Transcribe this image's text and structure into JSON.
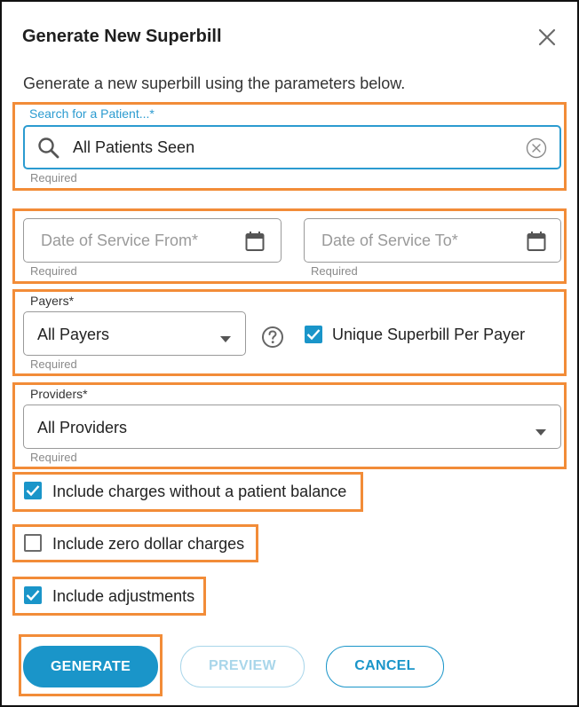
{
  "dialog": {
    "title": "Generate New Superbill",
    "subtitle": "Generate a new superbill using the parameters below."
  },
  "patient": {
    "label": "Search for a Patient...*",
    "value": "All Patients Seen",
    "helper": "Required"
  },
  "dates": {
    "from_placeholder": "Date of Service From*",
    "to_placeholder": "Date of Service To*",
    "from_helper": "Required",
    "to_helper": "Required"
  },
  "payers": {
    "label": "Payers*",
    "value": "All Payers",
    "helper": "Required",
    "unique_label": "Unique Superbill Per Payer",
    "unique_checked": true
  },
  "providers": {
    "label": "Providers*",
    "value": "All Providers",
    "helper": "Required"
  },
  "options": {
    "no_balance_label": "Include charges without a patient balance",
    "no_balance_checked": true,
    "zero_dollar_label": "Include zero dollar charges",
    "zero_dollar_checked": false,
    "adjustments_label": "Include adjustments",
    "adjustments_checked": true
  },
  "buttons": {
    "generate": "GENERATE",
    "preview": "PREVIEW",
    "cancel": "CANCEL"
  },
  "colors": {
    "primary": "#1a95c9",
    "highlight": "#f28c38",
    "disabled": "#a9d6ea"
  }
}
